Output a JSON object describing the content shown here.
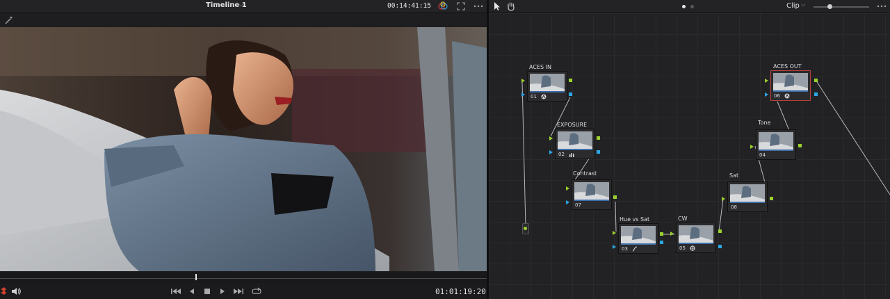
{
  "viewer": {
    "timeline_name": "Timeline 1",
    "source_timecode": "00:14:41:15",
    "record_timecode": "01:01:19:20"
  },
  "node_editor": {
    "mode_label": "Clip",
    "nodes": [
      {
        "id": "01",
        "label": "ACES IN",
        "icon": "aces-icon"
      },
      {
        "id": "02",
        "label": "EXPOSURE",
        "icon": "levels-icon"
      },
      {
        "id": "07",
        "label": "Contrast",
        "icon": ""
      },
      {
        "id": "03",
        "label": "Hue vs Sat",
        "icon": "curve-icon"
      },
      {
        "id": "05",
        "label": "CW",
        "icon": "color-wheel-icon"
      },
      {
        "id": "08",
        "label": "Sat",
        "icon": ""
      },
      {
        "id": "04",
        "label": "Tone",
        "icon": ""
      },
      {
        "id": "06",
        "label": "ACES OUT",
        "icon": "aces-icon"
      }
    ]
  },
  "colors": {
    "rgb_port": "#9bd12e",
    "alpha_port": "#2aa8e6",
    "selected_node": "#b6403a"
  }
}
